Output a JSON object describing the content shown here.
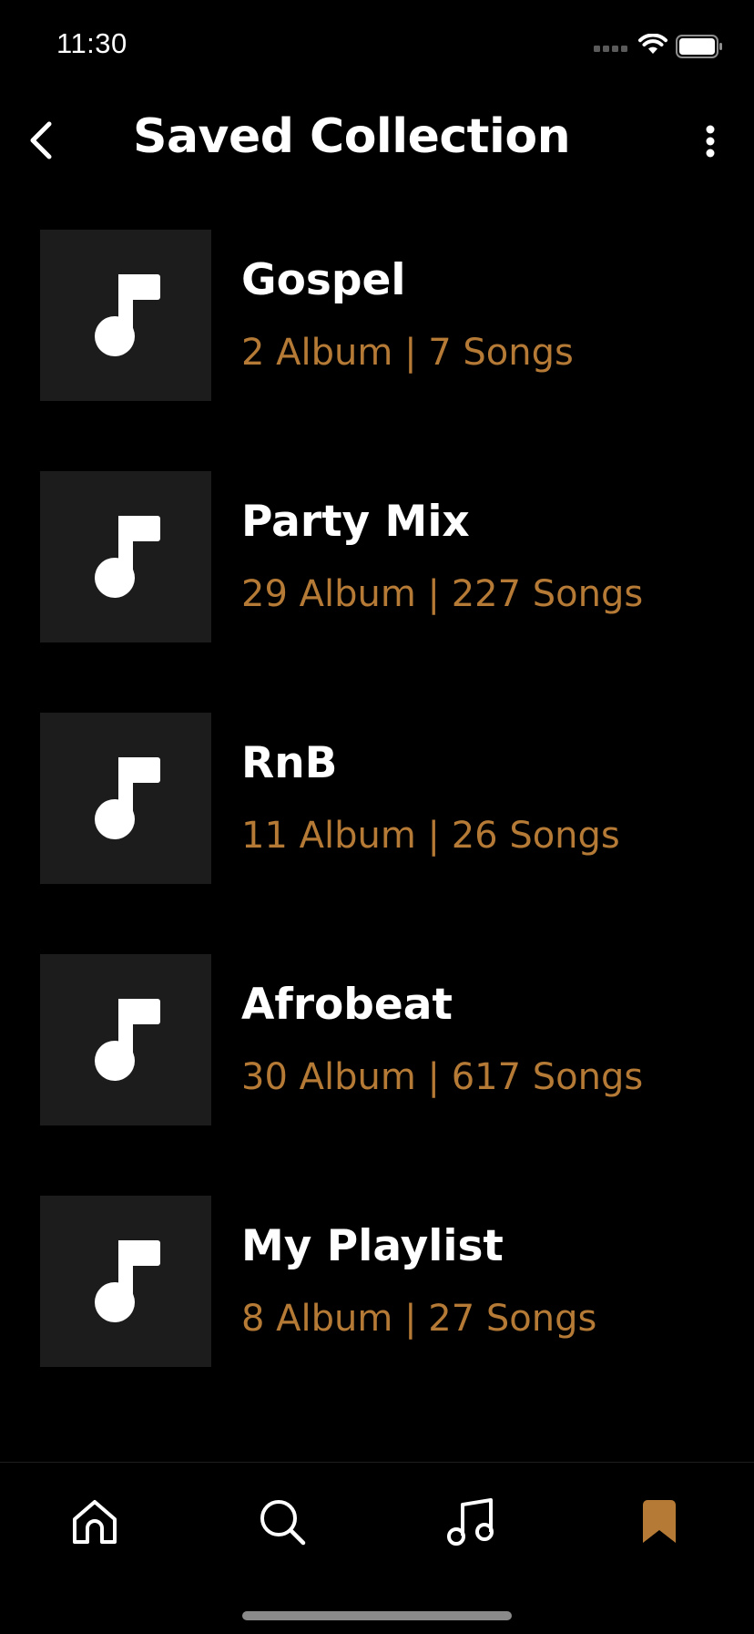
{
  "status_bar": {
    "time": "11:30"
  },
  "header": {
    "title": "Saved Collection",
    "back_icon": "chevron-left-icon",
    "more_icon": "more-vertical-icon"
  },
  "collections": [
    {
      "title": "Gospel",
      "meta": "2 Album | 7 Songs",
      "icon": "music-note-icon"
    },
    {
      "title": "Party Mix",
      "meta": "29 Album | 227 Songs",
      "icon": "music-note-icon"
    },
    {
      "title": "RnB",
      "meta": "11 Album | 26 Songs",
      "icon": "music-note-icon"
    },
    {
      "title": "Afrobeat",
      "meta": "30 Album | 617 Songs",
      "icon": "music-note-icon"
    },
    {
      "title": "My Playlist",
      "meta": "8 Album | 27 Songs",
      "icon": "music-note-icon"
    }
  ],
  "tab_bar": {
    "tabs": [
      {
        "icon": "home-icon",
        "active": false
      },
      {
        "icon": "search-icon",
        "active": false
      },
      {
        "icon": "music-icon",
        "active": false
      },
      {
        "icon": "bookmark-icon",
        "active": true
      }
    ]
  },
  "colors": {
    "background": "#000000",
    "accent": "#b57a35",
    "thumbnail": "#1c1c1c",
    "text": "#ffffff"
  }
}
